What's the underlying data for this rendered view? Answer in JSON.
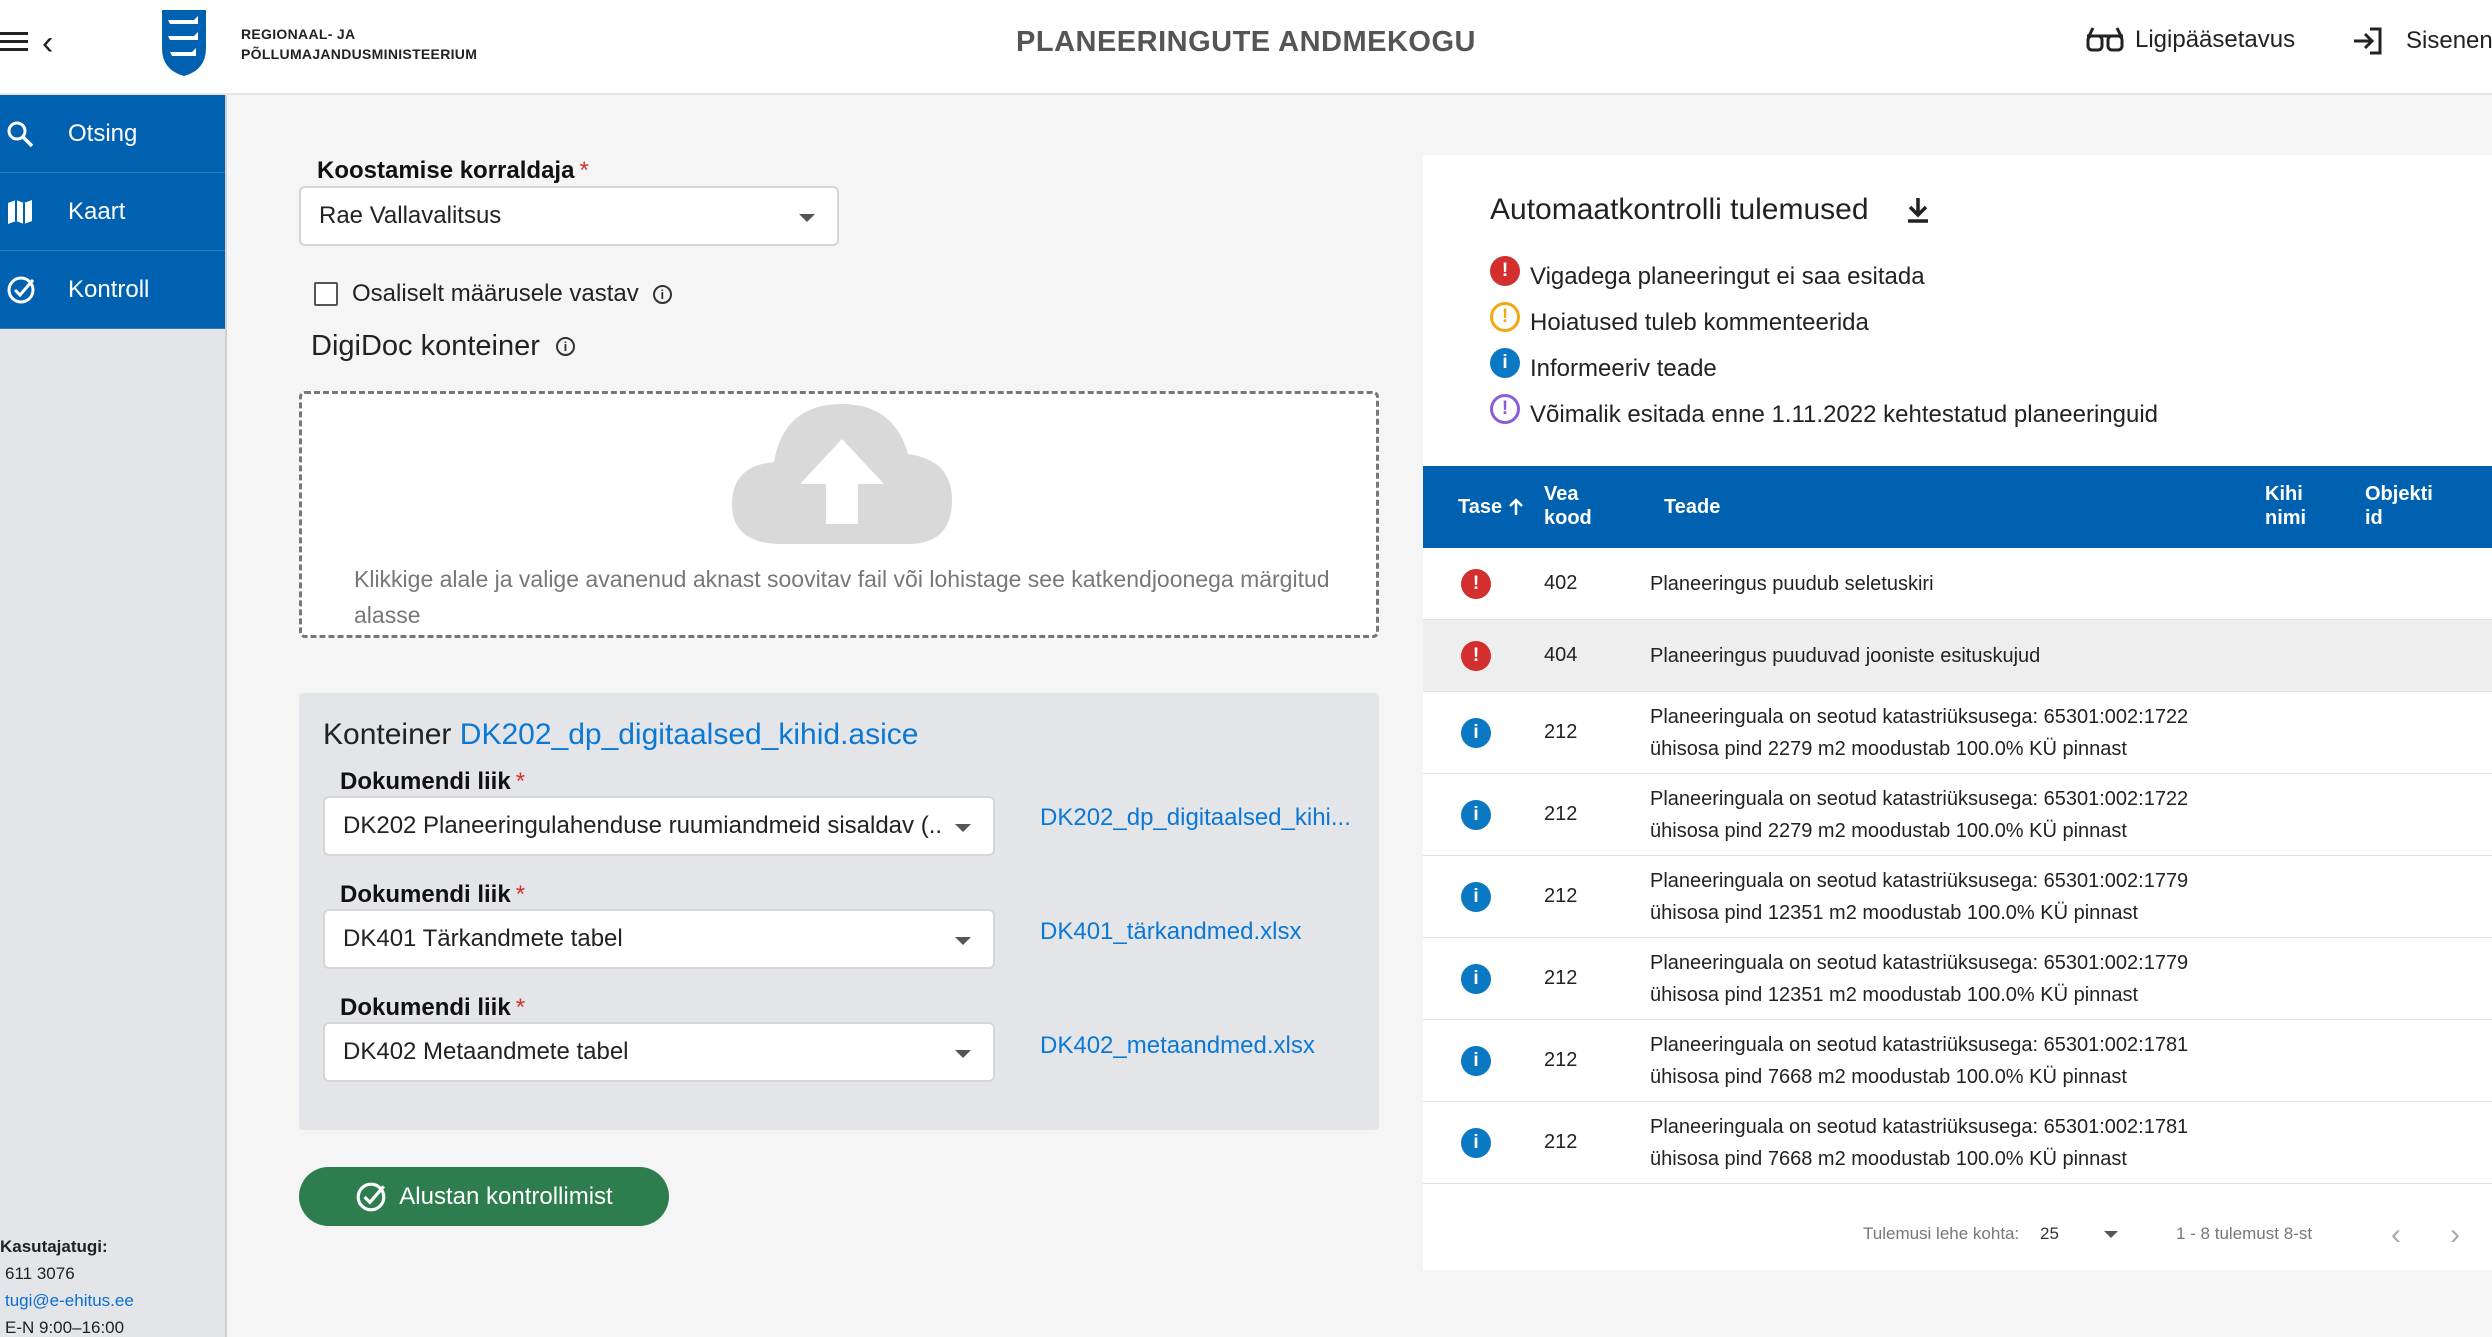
{
  "header": {
    "ministry_line1": "Regionaal- ja",
    "ministry_line2": "Põllumajandusministeerium",
    "title": "PLANEERINGUTE ANDMEKOGU",
    "accessibility_label": "Ligipääsetavus",
    "signin_label": "Sisenen"
  },
  "sidebar": {
    "items": [
      {
        "label": "Otsing",
        "icon": "search-icon"
      },
      {
        "label": "Kaart",
        "icon": "map-icon"
      },
      {
        "label": "Kontroll",
        "icon": "check-circle-icon"
      }
    ],
    "support": {
      "title": "Kasutajatugi:",
      "phone": "611 3076",
      "email": "tugi@e-ehitus.ee",
      "hours": "E-N 9:00–16:00"
    }
  },
  "form": {
    "organizer_label": "Koostamise korraldaja",
    "required_mark": "*",
    "organizer_value": "Rae Vallavalitsus",
    "partial_label": "Osaliselt määrusele vastav",
    "digidoc_title": "DigiDoc konteiner",
    "dropzone_text": "Klikkige alale ja valige avanenud aknast soovitav fail või lohistage see katkendjoonega märgitud alasse",
    "container_prefix": "Konteiner",
    "container_name": "DK202_dp_digitaalsed_kihid.asice",
    "doc_type_label": "Dokumendi liik",
    "documents": [
      {
        "type": "DK202 Planeeringulahenduse ruumiandmeid sisaldav (...",
        "file": "DK202_dp_digitaalsed_kihi..."
      },
      {
        "type": "DK401 Tärkandmete tabel",
        "file": "DK401_tärkandmed.xlsx"
      },
      {
        "type": "DK402 Metaandmete tabel",
        "file": "DK402_metaandmed.xlsx"
      }
    ],
    "start_button": "Alustan kontrollimist"
  },
  "results": {
    "title": "Automaatkontrolli tulemused",
    "legend": [
      {
        "kind": "error",
        "text": "Vigadega planeeringut ei saa esitada"
      },
      {
        "kind": "warning",
        "text": "Hoiatused tuleb kommenteerida"
      },
      {
        "kind": "info",
        "text": "Informeeriv teade"
      },
      {
        "kind": "purple",
        "text": "Võimalik esitada enne 1.11.2022 kehtestatud planeeringuid"
      }
    ],
    "columns": {
      "level": "Tase",
      "code_1": "Vea",
      "code_2": "kood",
      "message": "Teade",
      "layer_1": "Kihi",
      "layer_2": "nimi",
      "object_1": "Objekti",
      "object_2": "id"
    },
    "rows": [
      {
        "level": "error",
        "code": "402",
        "line1": "Planeeringus puudub seletuskiri",
        "line2": ""
      },
      {
        "level": "error",
        "code": "404",
        "line1": "Planeeringus puuduvad jooniste esituskujud",
        "line2": ""
      },
      {
        "level": "info",
        "code": "212",
        "line1": "Planeeringuala on seotud katastriüksusega: 65301:002:1722",
        "line2": "ühisosa pind 2279 m2 moodustab 100.0% KÜ pinnast"
      },
      {
        "level": "info",
        "code": "212",
        "line1": "Planeeringuala on seotud katastriüksusega: 65301:002:1722",
        "line2": "ühisosa pind 2279 m2 moodustab 100.0% KÜ pinnast"
      },
      {
        "level": "info",
        "code": "212",
        "line1": "Planeeringuala on seotud katastriüksusega: 65301:002:1779",
        "line2": "ühisosa pind 12351 m2 moodustab 100.0% KÜ pinnast"
      },
      {
        "level": "info",
        "code": "212",
        "line1": "Planeeringuala on seotud katastriüksusega: 65301:002:1779",
        "line2": "ühisosa pind 12351 m2 moodustab 100.0% KÜ pinnast"
      },
      {
        "level": "info",
        "code": "212",
        "line1": "Planeeringuala on seotud katastriüksusega: 65301:002:1781",
        "line2": "ühisosa pind 7668 m2 moodustab 100.0% KÜ pinnast"
      },
      {
        "level": "info",
        "code": "212",
        "line1": "Planeeringuala on seotud katastriüksusega: 65301:002:1781",
        "line2": "ühisosa pind 7668 m2 moodustab 100.0% KÜ pinnast"
      }
    ],
    "pager": {
      "per_page_label": "Tulemusi lehe kohta:",
      "per_page_value": "25",
      "range": "1 - 8 tulemust 8-st"
    }
  },
  "colors": {
    "primary": "#0061b0",
    "error": "#d32f2f",
    "warning": "#f3a712",
    "info": "#0b78c4",
    "purple": "#8c5bd6",
    "success": "#2e7d4f",
    "link": "#0b78d6"
  }
}
